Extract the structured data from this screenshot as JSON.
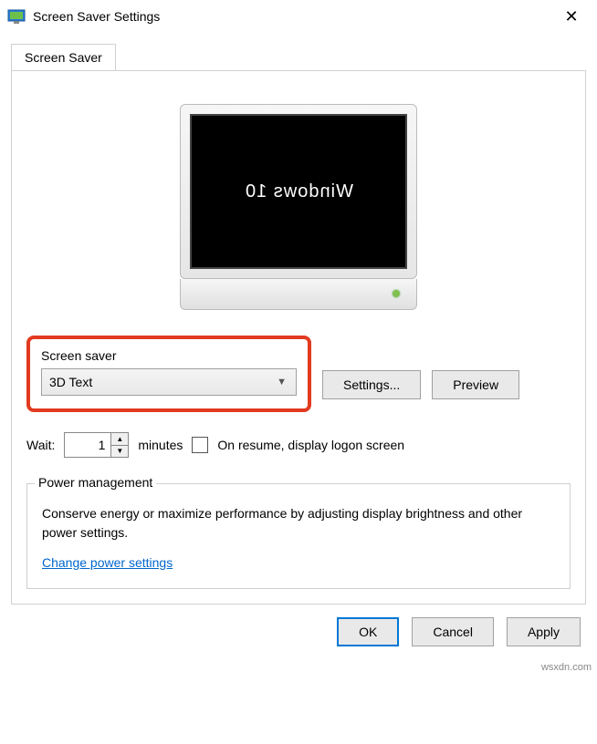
{
  "window": {
    "title": "Screen Saver Settings",
    "close": "✕"
  },
  "tab": {
    "label": "Screen Saver"
  },
  "preview": {
    "text": "Windows 10"
  },
  "screensaver": {
    "group_label": "Screen saver",
    "selected": "3D Text",
    "settings_btn": "Settings...",
    "preview_btn": "Preview"
  },
  "wait": {
    "label": "Wait:",
    "value": "1",
    "unit": "minutes",
    "resume_label": "On resume, display logon screen"
  },
  "power": {
    "legend": "Power management",
    "desc": "Conserve energy or maximize performance by adjusting display brightness and other power settings.",
    "link": "Change power settings"
  },
  "buttons": {
    "ok": "OK",
    "cancel": "Cancel",
    "apply": "Apply"
  },
  "watermark": "wsxdn.com"
}
